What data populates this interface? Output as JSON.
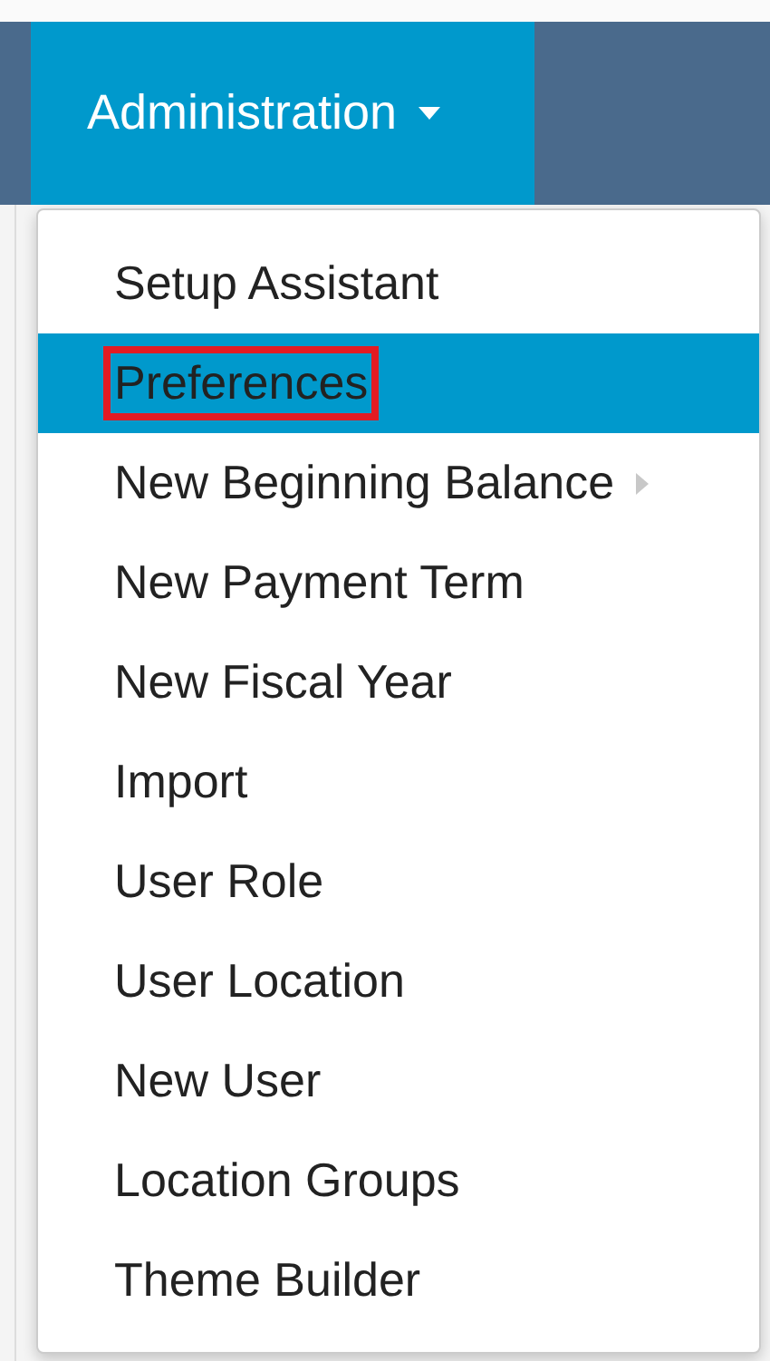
{
  "navbar": {
    "menu": {
      "label": "Administration",
      "expanded": true
    }
  },
  "dropdown": {
    "items": [
      {
        "label": "Setup Assistant",
        "selected": false,
        "outlined": false,
        "has_submenu": false
      },
      {
        "label": "Preferences",
        "selected": true,
        "outlined": true,
        "has_submenu": false
      },
      {
        "label": "New Beginning Balance",
        "selected": false,
        "outlined": false,
        "has_submenu": true
      },
      {
        "label": "New Payment Term",
        "selected": false,
        "outlined": false,
        "has_submenu": false
      },
      {
        "label": "New Fiscal Year",
        "selected": false,
        "outlined": false,
        "has_submenu": false
      },
      {
        "label": "Import",
        "selected": false,
        "outlined": false,
        "has_submenu": false
      },
      {
        "label": "User Role",
        "selected": false,
        "outlined": false,
        "has_submenu": false
      },
      {
        "label": "User Location",
        "selected": false,
        "outlined": false,
        "has_submenu": false
      },
      {
        "label": "New User",
        "selected": false,
        "outlined": false,
        "has_submenu": false
      },
      {
        "label": "Location Groups",
        "selected": false,
        "outlined": false,
        "has_submenu": false
      },
      {
        "label": "Theme Builder",
        "selected": false,
        "outlined": false,
        "has_submenu": false
      }
    ]
  }
}
